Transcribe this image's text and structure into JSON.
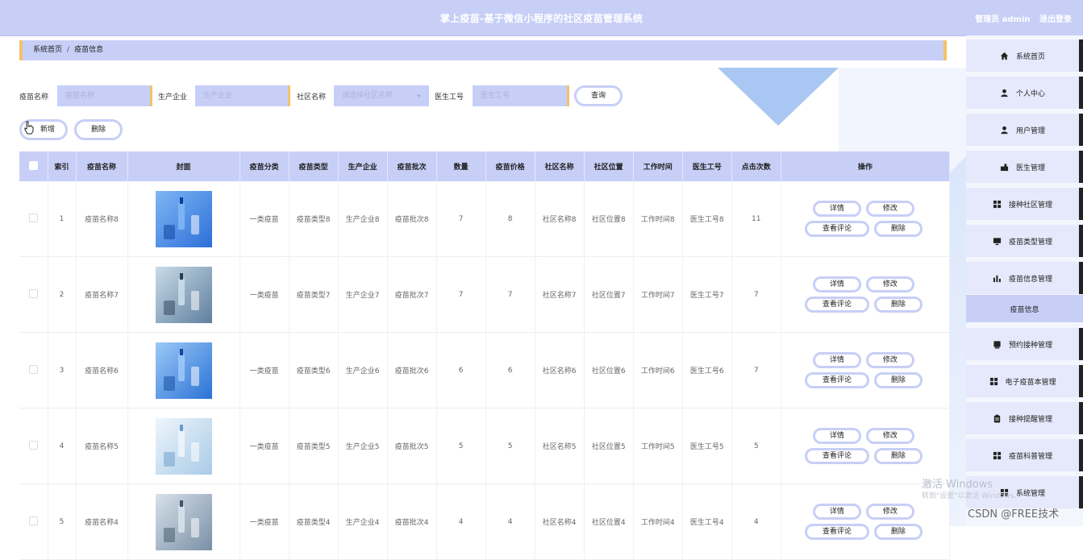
{
  "header": {
    "title": "掌上疫苗-基于微信小程序的社区疫苗管理系统",
    "user_label": "管理员 admin",
    "logout_label": "退出登录"
  },
  "breadcrumb": {
    "home": "系统首页",
    "separator": "/",
    "current": "疫苗信息"
  },
  "search": {
    "vaccine_name_label": "疫苗名称",
    "vaccine_name_placeholder": "疫苗名称",
    "manufacturer_label": "生产企业",
    "manufacturer_placeholder": "生产企业",
    "community_label": "社区名称",
    "community_placeholder": "请选择社区名称",
    "doctor_id_label": "医生工号",
    "doctor_id_placeholder": "医生工号",
    "query_button": "查询"
  },
  "toolbar": {
    "add_button": "新增",
    "delete_button": "删除"
  },
  "table": {
    "headers": [
      "",
      "索引",
      "疫苗名称",
      "封面",
      "疫苗分类",
      "疫苗类型",
      "生产企业",
      "疫苗批次",
      "数量",
      "疫苗价格",
      "社区名称",
      "社区位置",
      "工作时间",
      "医生工号",
      "点击次数",
      "操作"
    ],
    "actions": {
      "detail": "详情",
      "edit": "修改",
      "comments": "查看评论",
      "delete": "删除"
    },
    "rows": [
      {
        "index": "1",
        "name": "疫苗名称8",
        "category": "一类疫苗",
        "type": "疫苗类型8",
        "manufacturer": "生产企业8",
        "batch": "疫苗批次8",
        "quantity": "7",
        "price": "8",
        "community": "社区名称8",
        "location": "社区位置8",
        "work_time": "工作时间8",
        "doctor_id": "医生工号8",
        "clicks": "11"
      },
      {
        "index": "2",
        "name": "疫苗名称7",
        "category": "一类疫苗",
        "type": "疫苗类型7",
        "manufacturer": "生产企业7",
        "batch": "疫苗批次7",
        "quantity": "7",
        "price": "7",
        "community": "社区名称7",
        "location": "社区位置7",
        "work_time": "工作时间7",
        "doctor_id": "医生工号7",
        "clicks": "7"
      },
      {
        "index": "3",
        "name": "疫苗名称6",
        "category": "一类疫苗",
        "type": "疫苗类型6",
        "manufacturer": "生产企业6",
        "batch": "疫苗批次6",
        "quantity": "6",
        "price": "6",
        "community": "社区名称6",
        "location": "社区位置6",
        "work_time": "工作时间6",
        "doctor_id": "医生工号6",
        "clicks": "7"
      },
      {
        "index": "4",
        "name": "疫苗名称5",
        "category": "一类疫苗",
        "type": "疫苗类型5",
        "manufacturer": "生产企业5",
        "batch": "疫苗批次5",
        "quantity": "5",
        "price": "5",
        "community": "社区名称5",
        "location": "社区位置5",
        "work_time": "工作时间5",
        "doctor_id": "医生工号5",
        "clicks": "5"
      },
      {
        "index": "5",
        "name": "疫苗名称4",
        "category": "一类疫苗",
        "type": "疫苗类型4",
        "manufacturer": "生产企业4",
        "batch": "疫苗批次4",
        "quantity": "4",
        "price": "4",
        "community": "社区名称4",
        "location": "社区位置4",
        "work_time": "工作时间4",
        "doctor_id": "医生工号4",
        "clicks": "4"
      }
    ]
  },
  "sidebar": {
    "items": [
      {
        "label": "系统首页",
        "icon": "home-icon"
      },
      {
        "label": "个人中心",
        "icon": "user-icon"
      },
      {
        "label": "用户管理",
        "icon": "user-icon"
      },
      {
        "label": "医生管理",
        "icon": "doctor-icon"
      },
      {
        "label": "接种社区管理",
        "icon": "grid-icon"
      },
      {
        "label": "疫苗类型管理",
        "icon": "monitor-icon"
      },
      {
        "label": "疫苗信息管理",
        "icon": "bar-chart-icon"
      },
      {
        "label": "预约接种管理",
        "icon": "calendar-icon"
      },
      {
        "label": "电子疫苗本管理",
        "icon": "grid-icon"
      },
      {
        "label": "接种提醒管理",
        "icon": "clipboard-icon"
      },
      {
        "label": "疫苗科普管理",
        "icon": "grid-icon"
      },
      {
        "label": "系统管理",
        "icon": "grid-icon"
      }
    ],
    "active_submenu": "疫苗信息"
  },
  "watermark": {
    "line1": "激活 Windows",
    "line2": "转到\"设置\"以激活 Windows。"
  },
  "credit": "CSDN @FREE技术"
}
